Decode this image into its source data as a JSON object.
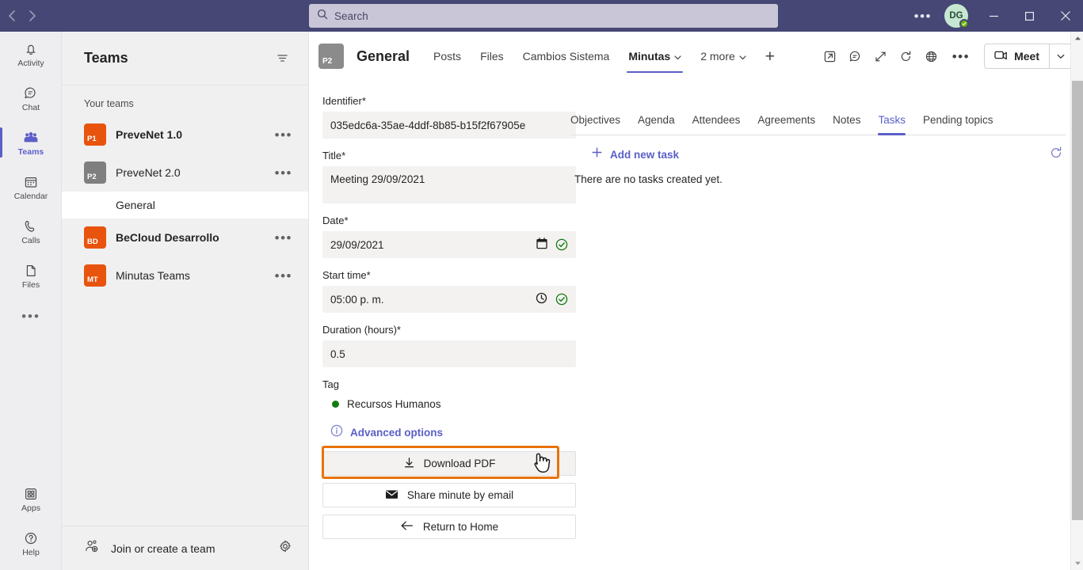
{
  "titlebar": {
    "back_icon": "chevron-left-icon",
    "forward_icon": "chevron-right-icon",
    "search_placeholder": "Search",
    "search_value": "",
    "search_icon": "search-icon",
    "more_label": "•••",
    "avatar_initials": "DG",
    "presence_status": "available",
    "minimize_label": "Minimize",
    "maximize_label": "Restore",
    "close_label": "Close",
    "bg_color": "#464775"
  },
  "rail": {
    "items": [
      {
        "label": "Activity",
        "icon": "bell-icon",
        "active": false
      },
      {
        "label": "Chat",
        "icon": "chat-icon",
        "active": false
      },
      {
        "label": "Teams",
        "icon": "teams-icon",
        "active": true
      },
      {
        "label": "Calendar",
        "icon": "calendar-icon",
        "active": false
      },
      {
        "label": "Calls",
        "icon": "phone-icon",
        "active": false
      },
      {
        "label": "Files",
        "icon": "file-icon",
        "active": false
      }
    ],
    "more_label": "•••",
    "bottom": [
      {
        "label": "Apps",
        "icon": "apps-icon"
      },
      {
        "label": "Help",
        "icon": "help-icon"
      }
    ],
    "accent_color": "#5b5fc7"
  },
  "teams_panel": {
    "title": "Teams",
    "filter_icon": "filter-icon",
    "section_label": "Your teams",
    "teams": [
      {
        "initials": "P1",
        "name": "PreveNet 1.0",
        "color": "#e8530e",
        "bold": true,
        "channels": []
      },
      {
        "initials": "P2",
        "name": "PreveNet 2.0",
        "color": "#7f7f7f",
        "bold": false,
        "channels": [
          {
            "name": "General",
            "active": true
          }
        ]
      },
      {
        "initials": "BD",
        "name": "BeCloud Desarrollo",
        "color": "#e8530e",
        "bold": true,
        "channels": []
      },
      {
        "initials": "MT",
        "name": "Minutas Teams",
        "color": "#e8530e",
        "bold": false,
        "channels": []
      }
    ],
    "row_menu_label": "•••",
    "footer_label": "Join or create a team",
    "footer_icon": "add-people-icon",
    "settings_icon": "gear-icon"
  },
  "channel_header": {
    "team_initials": "P2",
    "channel_name": "General",
    "tabs": [
      {
        "label": "Posts",
        "active": false,
        "caret": false
      },
      {
        "label": "Files",
        "active": false,
        "caret": false
      },
      {
        "label": "Cambios Sistema",
        "active": false,
        "caret": false
      },
      {
        "label": "Minutas",
        "active": true,
        "caret": true
      },
      {
        "label": "2 more",
        "active": false,
        "caret": true
      }
    ],
    "add_tab_label": "+",
    "tools": [
      "popout-icon",
      "chat-icon",
      "expand-icon",
      "refresh-icon",
      "globe-icon"
    ],
    "more_label": "•••",
    "meet_label": "Meet",
    "meet_icon": "video-camera-icon",
    "meet_caret_icon": "chevron-down-icon"
  },
  "form": {
    "fields": [
      {
        "label": "Identifier*",
        "value": "035edc6a-35ae-4ddf-8b85-b15f2f67905e",
        "tall": false,
        "icons": []
      },
      {
        "label": "Title*",
        "value": "Meeting  29/09/2021",
        "tall": true,
        "icons": []
      },
      {
        "label": "Date*",
        "value": "29/09/2021",
        "tall": false,
        "icons": [
          "calendar-picker-icon",
          "valid-check-icon"
        ]
      },
      {
        "label": "Start time*",
        "value": "05:00 p. m.",
        "tall": false,
        "icons": [
          "clock-picker-icon",
          "valid-check-icon"
        ]
      },
      {
        "label": "Duration (hours)*",
        "value": "0.5",
        "tall": false,
        "icons": []
      }
    ],
    "tag_label": "Tag",
    "tag_name": "Recursos Humanos",
    "tag_color": "#107c10",
    "advanced_label": "Advanced options",
    "advanced_icon": "info-icon",
    "buttons": [
      {
        "label": "Download PDF",
        "icon": "download-icon",
        "highlighted": true
      },
      {
        "label": "Share minute by email",
        "icon": "envelope-icon",
        "highlighted": false
      },
      {
        "label": "Return to Home",
        "icon": "arrow-left-icon",
        "highlighted": false
      }
    ],
    "highlight_color": "#e8730a",
    "cursor_icon": "pointing-hand-cursor"
  },
  "detail_panel": {
    "tabs": [
      {
        "label": "Objectives",
        "active": false
      },
      {
        "label": "Agenda",
        "active": false
      },
      {
        "label": "Attendees",
        "active": false
      },
      {
        "label": "Agreements",
        "active": false
      },
      {
        "label": "Notes",
        "active": false
      },
      {
        "label": "Tasks",
        "active": true
      },
      {
        "label": "Pending topics",
        "active": false
      }
    ],
    "add_label": "Add new task",
    "add_icon": "plus-icon",
    "refresh_icon": "refresh-icon",
    "empty_message": "There are no tasks created yet."
  },
  "scrollbar": {
    "up_icon": "scroll-up-arrow",
    "down_icon": "scroll-down-arrow"
  }
}
